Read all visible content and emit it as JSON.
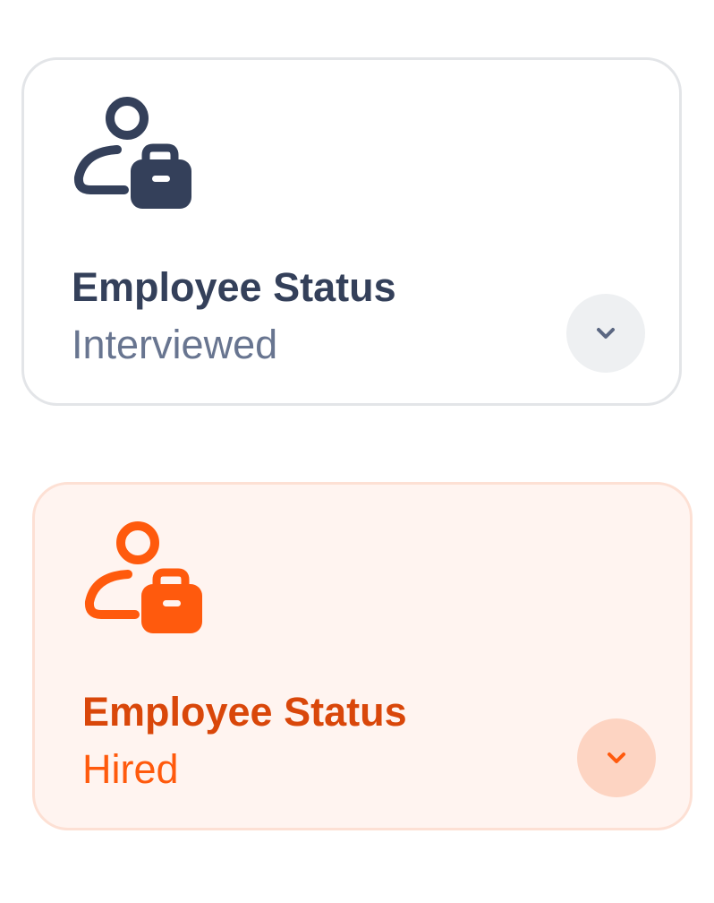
{
  "cards": [
    {
      "title": "Employee Status",
      "value": "Interviewed",
      "state": "default",
      "icon": "employee-briefcase-icon",
      "colors": {
        "icon": "#34405a",
        "title": "#34405a",
        "value": "#687590",
        "button_bg": "#eef0f2",
        "chevron": "#5b6782"
      }
    },
    {
      "title": "Employee Status",
      "value": "Hired",
      "state": "selected",
      "icon": "employee-briefcase-icon",
      "colors": {
        "icon": "#ff5a0d",
        "title": "#d9470a",
        "value": "#ff5a0d",
        "button_bg": "#fdd4c2",
        "chevron": "#ff5a0d"
      }
    }
  ]
}
